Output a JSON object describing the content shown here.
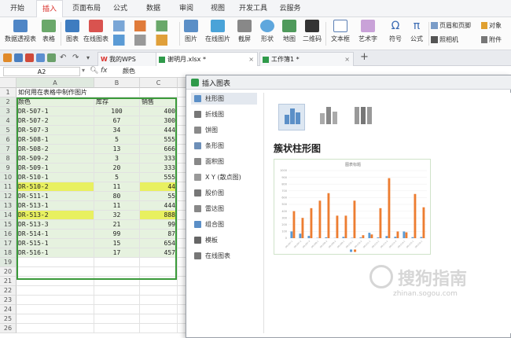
{
  "menu": {
    "tabs": [
      "开始",
      "插入",
      "页面布局",
      "公式",
      "数据",
      "审阅",
      "视图",
      "开发工具",
      "云服务"
    ],
    "active": 1
  },
  "ribbon": {
    "pivot": "数据透视表",
    "table": "表格",
    "chart": "图表",
    "online_chart": "在线图表",
    "picture": "图片",
    "online_picture": "在线图片",
    "screenshot": "截屏",
    "shape": "形状",
    "map": "地图",
    "qrcode": "二维码",
    "textbox": "文本框",
    "wordart": "艺术字",
    "symbol": "符号",
    "formula": "公式",
    "header_footer": "页眉和页脚",
    "object": "对象",
    "camera": "照相机",
    "attachment": "附件"
  },
  "doctabs": {
    "wps": "我的WPS",
    "file1": "谢明月.xlsx *",
    "file2": "工作簿1 *",
    "add": "+"
  },
  "formula": {
    "cellref": "A2",
    "fx": "fx",
    "value": "颜色"
  },
  "sheet": {
    "cols": [
      "A",
      "B",
      "C"
    ],
    "rows": [
      "1",
      "2",
      "3",
      "4",
      "5",
      "6",
      "7",
      "8",
      "9",
      "10",
      "11",
      "12",
      "13",
      "14",
      "15",
      "16",
      "17",
      "18",
      "19",
      "20",
      "21",
      "22",
      "23",
      "24",
      "25",
      "26"
    ],
    "title": "如何用在表格中制作图片",
    "headers": [
      "颜色",
      "库存",
      "销售"
    ],
    "data": [
      [
        "DR-507-1",
        "100",
        "400"
      ],
      [
        "DR-507-2",
        "67",
        "300"
      ],
      [
        "DR-507-3",
        "34",
        "444"
      ],
      [
        "DR-508-1",
        "5",
        "555"
      ],
      [
        "DR-508-2",
        "13",
        "666"
      ],
      [
        "DR-509-2",
        "3",
        "333"
      ],
      [
        "DR-509-1",
        "20",
        "333"
      ],
      [
        "DR-510-1",
        "5",
        "555"
      ],
      [
        "DR-510-2",
        "11",
        "44"
      ],
      [
        "DR-511-1",
        "80",
        "55"
      ],
      [
        "DR-513-1",
        "11",
        "444"
      ],
      [
        "DR-513-2",
        "32",
        "888"
      ],
      [
        "DR-513-3",
        "21",
        "99"
      ],
      [
        "DR-514-1",
        "99",
        "87"
      ],
      [
        "DR-515-1",
        "15",
        "654"
      ],
      [
        "DR-516-1",
        "17",
        "457"
      ]
    ]
  },
  "dialog": {
    "title": "插入图表",
    "types": [
      "柱形图",
      "折线图",
      "饼图",
      "条形图",
      "面积图",
      "X Y (散点图)",
      "股价图",
      "雷达图",
      "组合图",
      "模板",
      "在线图表"
    ],
    "selected": 0,
    "subtitle": "簇状柱形图",
    "preview_title": "图表标题",
    "legend": "■ ■"
  },
  "chart_data": {
    "type": "bar",
    "title": "图表标题",
    "categories": [
      "DR-507-1",
      "DR-507-2",
      "DR-507-3",
      "DR-508-1",
      "DR-508-2",
      "DR-509-2",
      "DR-509-1",
      "DR-510-1",
      "DR-510-2",
      "DR-511-1",
      "DR-513-1",
      "DR-513-2",
      "DR-513-3",
      "DR-514-1",
      "DR-515-1",
      "DR-516-1"
    ],
    "series": [
      {
        "values": [
          100,
          67,
          34,
          5,
          13,
          3,
          20,
          5,
          11,
          80,
          11,
          32,
          21,
          99,
          15,
          17
        ],
        "color": "#5b9bd5"
      },
      {
        "values": [
          400,
          300,
          444,
          555,
          666,
          333,
          333,
          555,
          44,
          55,
          444,
          888,
          99,
          87,
          654,
          457
        ],
        "color": "#ed7d31"
      }
    ],
    "ylim": [
      0,
      1000
    ]
  },
  "watermark": {
    "brand": "搜狗指南",
    "url": "zhinan.sogou.com"
  }
}
